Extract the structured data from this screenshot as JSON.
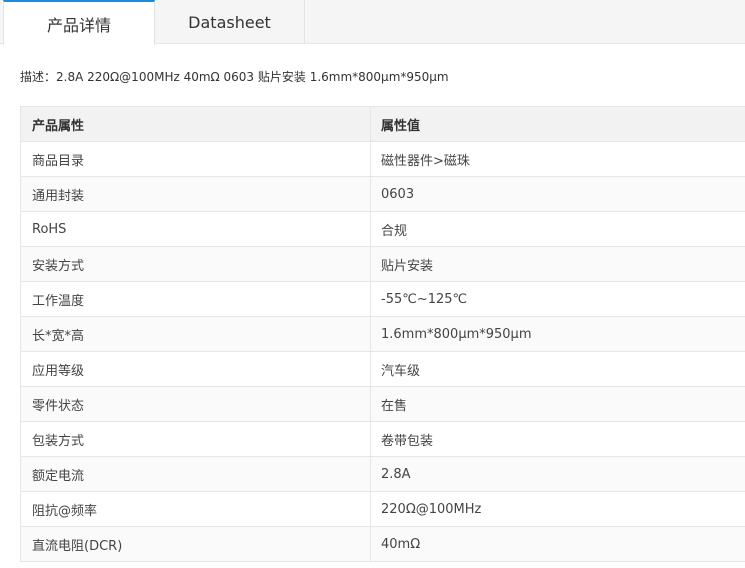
{
  "tabs": [
    {
      "label": "产品详情"
    },
    {
      "label": "Datasheet"
    }
  ],
  "description": "描述：2.8A 220Ω@100MHz 40mΩ 0603 贴片安装 1.6mm*800µm*950µm",
  "table": {
    "headers": {
      "key": "产品属性",
      "value": "属性值"
    },
    "rows": [
      {
        "key": "商品目录",
        "value": "磁性器件>磁珠"
      },
      {
        "key": "通用封装",
        "value": "0603"
      },
      {
        "key": "RoHS",
        "value": "合规"
      },
      {
        "key": "安装方式",
        "value": "贴片安装"
      },
      {
        "key": "工作温度",
        "value": "-55℃~125℃"
      },
      {
        "key": "长*宽*高",
        "value": "1.6mm*800µm*950µm"
      },
      {
        "key": "应用等级",
        "value": "汽车级"
      },
      {
        "key": "零件状态",
        "value": "在售"
      },
      {
        "key": "包装方式",
        "value": "卷带包装"
      },
      {
        "key": "额定电流",
        "value": "2.8A"
      },
      {
        "key": "阻抗@频率",
        "value": "220Ω@100MHz"
      },
      {
        "key": "直流电阻(DCR)",
        "value": "40mΩ"
      }
    ]
  }
}
